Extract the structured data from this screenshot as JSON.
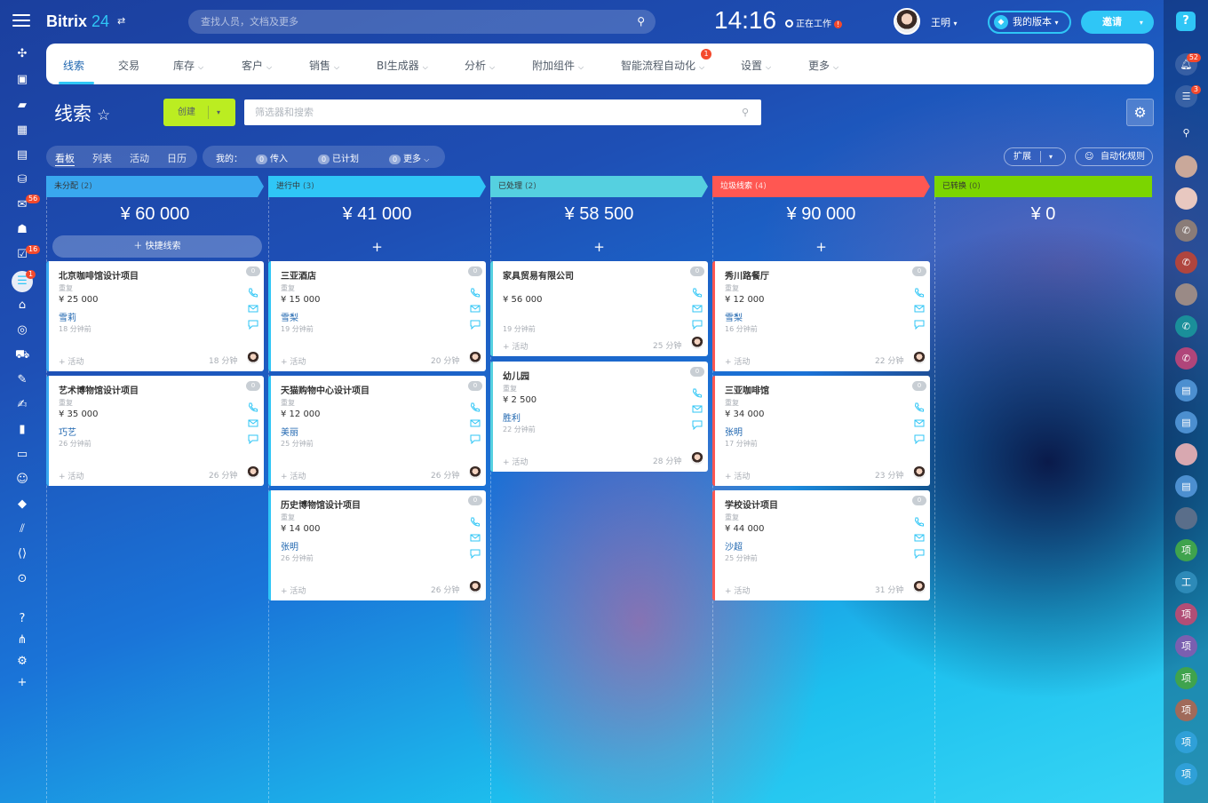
{
  "app": {
    "logo_name": "Bitrix",
    "logo_num": "24",
    "logo_switch": "⇄"
  },
  "search": {
    "placeholder": "查找人员，文档及更多"
  },
  "clock": "14:16",
  "work_status": {
    "label": "正在工作",
    "badge": "!"
  },
  "user": {
    "name": "王明"
  },
  "version_btn": "我的版本",
  "invite_btn": "邀请",
  "left_badges": {
    "mail": "56",
    "tasks": "16",
    "crm": "1"
  },
  "right_badges": {
    "notifications": "52",
    "chat": "3"
  },
  "right_avatars": [
    "项",
    "工",
    "项",
    "项",
    "项",
    "项",
    "项",
    "项"
  ],
  "nav": {
    "items": [
      "线索",
      "交易",
      "库存",
      "客户",
      "销售",
      "BI生成器",
      "分析",
      "附加组件",
      "智能流程自动化",
      "设置",
      "更多"
    ],
    "automation_badge": "1"
  },
  "page": {
    "title": "线索",
    "star": "☆"
  },
  "create_btn": "创建",
  "filter": {
    "placeholder": "筛选器和搜索"
  },
  "view_tabs": [
    "看板",
    "列表",
    "活动",
    "日历"
  ],
  "counters": {
    "label": "我的：",
    "incoming": "传入",
    "planned": "已计划",
    "more": "更多",
    "zero": "0"
  },
  "expand_btn": "扩展",
  "automation_btn": "自动化规则",
  "quick_lead": "快捷线索",
  "columns": [
    {
      "name": "未分配",
      "count": "(2)",
      "total": "¥ 60 000",
      "color": "#39a8ef"
    },
    {
      "name": "进行中",
      "count": "(3)",
      "total": "¥ 41 000",
      "color": "#2fc6f6"
    },
    {
      "name": "已处理",
      "count": "(2)",
      "total": "¥ 58 500",
      "color": "#55d0e0"
    },
    {
      "name": "垃圾线索",
      "count": "(4)",
      "total": "¥ 90 000",
      "color": "#ff5752"
    },
    {
      "name": "已转换",
      "count": "(0)",
      "total": "¥ 0",
      "color": "#7bd500"
    }
  ],
  "cards": [
    {
      "title": "北京咖啡馆设计项目",
      "repeat": "重复",
      "price": "¥ 25 000",
      "user": "雪莉",
      "ago": "18 分钟前",
      "activity": "+ 活动",
      "minutes": "18 分钟",
      "zero": "0"
    },
    {
      "title": "艺术博物馆设计项目",
      "repeat": "重复",
      "price": "¥ 35 000",
      "user": "巧艺",
      "ago": "26 分钟前",
      "activity": "+ 活动",
      "minutes": "26 分钟",
      "zero": "0"
    },
    {
      "title": "三亚酒店",
      "repeat": "重复",
      "price": "¥ 15 000",
      "user": "雪梨",
      "ago": "19 分钟前",
      "activity": "+ 活动",
      "minutes": "20 分钟",
      "zero": "0"
    },
    {
      "title": "天猫购物中心设计项目",
      "repeat": "重复",
      "price": "¥ 12 000",
      "user": "美丽",
      "ago": "25 分钟前",
      "activity": "+ 活动",
      "minutes": "26 分钟",
      "zero": "0"
    },
    {
      "title": "历史博物馆设计项目",
      "repeat": "重复",
      "price": "¥ 14 000",
      "user": "张明",
      "ago": "26 分钟前",
      "activity": "+ 活动",
      "minutes": "26 分钟",
      "zero": "0"
    },
    {
      "title": "家具贸易有限公司",
      "repeat": "",
      "price": "¥ 56 000",
      "user": "",
      "ago": "19 分钟前",
      "activity": "+ 活动",
      "minutes": "25 分钟",
      "zero": "0"
    },
    {
      "title": "幼儿园",
      "repeat": "重复",
      "price": "¥ 2 500",
      "user": "胜利",
      "ago": "22 分钟前",
      "activity": "+ 活动",
      "minutes": "28 分钟",
      "zero": "0"
    },
    {
      "title": "秀川路餐厅",
      "repeat": "重复",
      "price": "¥ 12 000",
      "user": "雪梨",
      "ago": "16 分钟前",
      "activity": "+ 活动",
      "minutes": "22 分钟",
      "zero": "0"
    },
    {
      "title": "三亚咖啡馆",
      "repeat": "重复",
      "price": "¥ 34 000",
      "user": "张明",
      "ago": "17 分钟前",
      "activity": "+ 活动",
      "minutes": "23 分钟",
      "zero": "0"
    },
    {
      "title": "学校设计项目",
      "repeat": "重复",
      "price": "¥ 44 000",
      "user": "沙超",
      "ago": "25 分钟前",
      "activity": "+ 活动",
      "minutes": "31 分钟",
      "zero": "0"
    }
  ],
  "colors": {
    "accent": "#2fc6f6",
    "create": "#bbed21",
    "link": "#2067b0",
    "badge": "#f4492c"
  }
}
